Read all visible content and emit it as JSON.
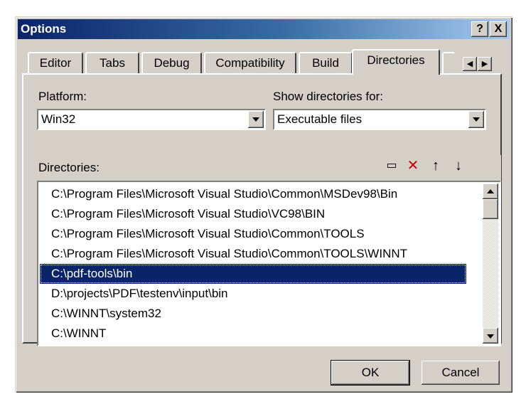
{
  "window": {
    "title": "Options",
    "help_button": "?",
    "close_button": "X"
  },
  "tabs": [
    {
      "label": "Editor"
    },
    {
      "label": "Tabs"
    },
    {
      "label": "Debug"
    },
    {
      "label": "Compatibility"
    },
    {
      "label": "Build"
    },
    {
      "label": "Directories",
      "active": true
    }
  ],
  "platform": {
    "label": "Platform:",
    "value": "Win32"
  },
  "show_for": {
    "label": "Show directories for:",
    "value": "Executable files"
  },
  "directories": {
    "label": "Directories:",
    "items": [
      "C:\\Program Files\\Microsoft Visual Studio\\Common\\MSDev98\\Bin",
      "C:\\Program Files\\Microsoft Visual Studio\\VC98\\BIN",
      "C:\\Program Files\\Microsoft Visual Studio\\Common\\TOOLS",
      "C:\\Program Files\\Microsoft Visual Studio\\Common\\TOOLS\\WINNT",
      "C:\\pdf-tools\\bin",
      "D:\\projects\\PDF\\testenv\\input\\bin",
      "C:\\WINNT\\system32",
      "C:\\WINNT"
    ],
    "selected_index": 4
  },
  "buttons": {
    "ok": "OK",
    "cancel": "Cancel"
  },
  "colors": {
    "title_bar": "#0a246a",
    "selection": "#0a246a",
    "face": "#d4d0c8",
    "delete_icon": "#cc0000"
  }
}
